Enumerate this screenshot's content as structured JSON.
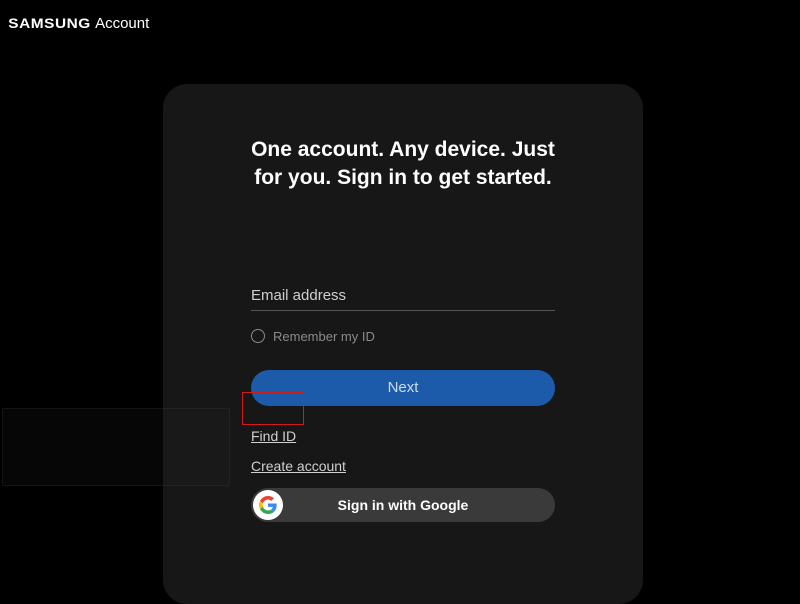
{
  "header": {
    "logo": "SAMSUNG",
    "sub": "Account"
  },
  "card": {
    "hero": "One account. Any device. Just for you. Sign in to get started.",
    "email_placeholder": "Email address",
    "remember_label": "Remember my ID",
    "next_label": "Next",
    "find_id_label": "Find ID",
    "create_account_label": "Create account",
    "google_label": "Sign in with Google"
  }
}
